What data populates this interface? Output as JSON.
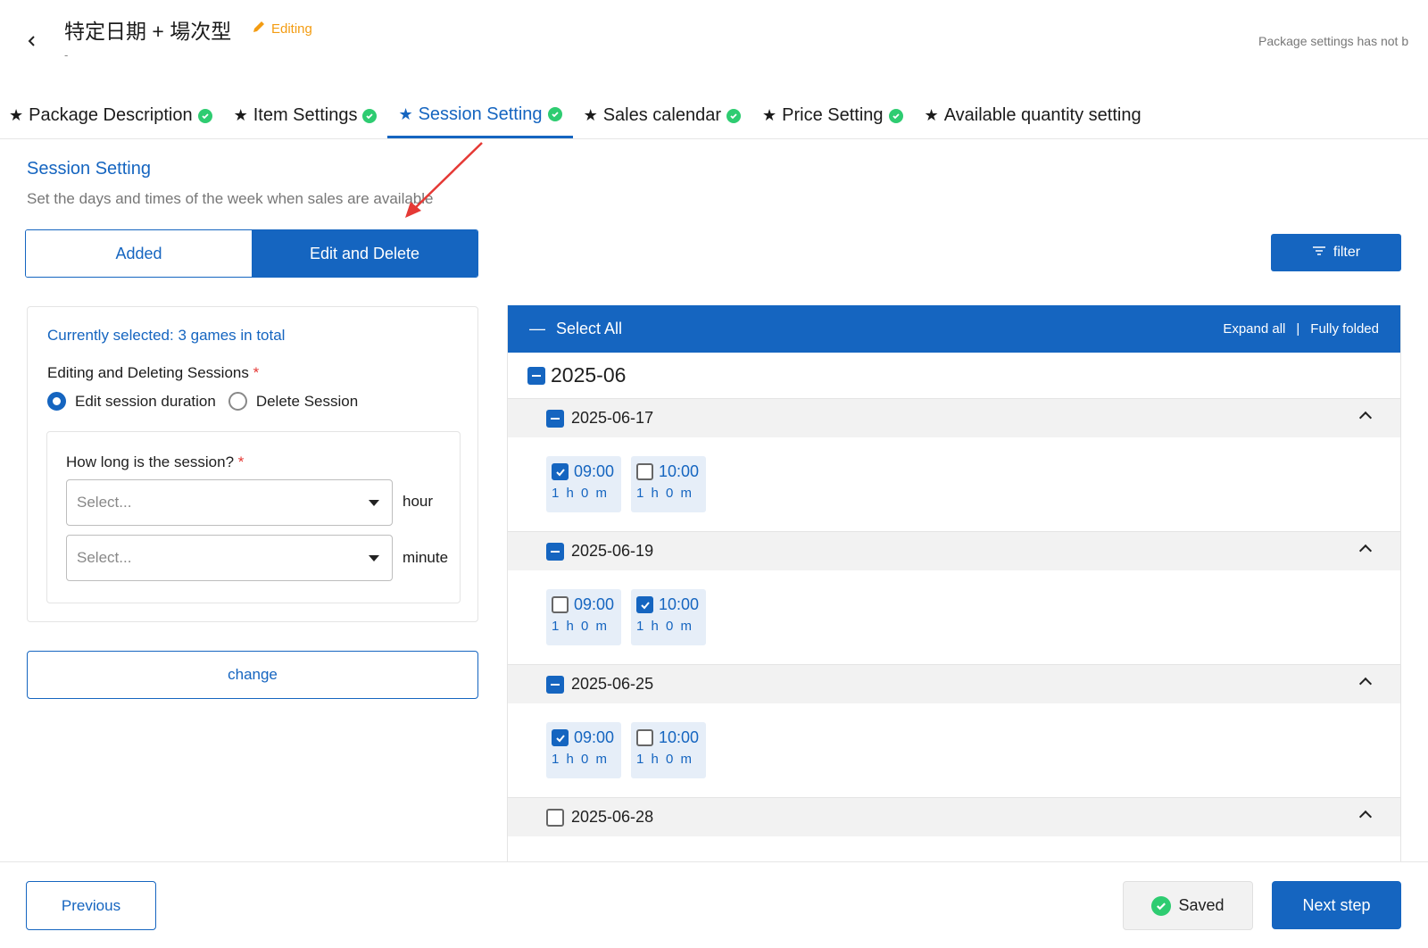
{
  "header": {
    "title": "特定日期 + 場次型",
    "editing_label": "Editing",
    "subtitle": "-",
    "status_text": "Package settings has not b"
  },
  "tabs": [
    {
      "label": "Package Description",
      "complete": true
    },
    {
      "label": "Item Settings",
      "complete": true
    },
    {
      "label": "Session Setting",
      "complete": true,
      "active": true
    },
    {
      "label": "Sales calendar",
      "complete": true
    },
    {
      "label": "Price Setting",
      "complete": true
    },
    {
      "label": "Available quantity setting",
      "complete": false
    }
  ],
  "section": {
    "title": "Session Setting",
    "description": "Set the days and times of the week when sales are available"
  },
  "mode_toggle": {
    "added_label": "Added",
    "edit_label": "Edit and Delete",
    "active": "edit"
  },
  "filter_label": "filter",
  "left_panel": {
    "selected_count": "Currently selected: 3 games in total",
    "edit_label": "Editing and Deleting Sessions",
    "option_edit": "Edit session duration",
    "option_delete": "Delete Session",
    "duration_label": "How long is the session?",
    "hour_placeholder": "Select...",
    "hour_unit": "hour",
    "minute_placeholder": "Select...",
    "minute_unit": "minute",
    "change_label": "change"
  },
  "tree": {
    "select_all_label": "Select All",
    "expand_all_label": "Expand all",
    "separator": "|",
    "fully_folded_label": "Fully folded",
    "month": "2025-06",
    "days": [
      {
        "date": "2025-06-17",
        "state": "partial",
        "slots": [
          {
            "time": "09:00",
            "duration": "1 h 0 m",
            "checked": true
          },
          {
            "time": "10:00",
            "duration": "1 h 0 m",
            "checked": false
          }
        ]
      },
      {
        "date": "2025-06-19",
        "state": "partial",
        "slots": [
          {
            "time": "09:00",
            "duration": "1 h 0 m",
            "checked": false
          },
          {
            "time": "10:00",
            "duration": "1 h 0 m",
            "checked": true
          }
        ]
      },
      {
        "date": "2025-06-25",
        "state": "partial",
        "slots": [
          {
            "time": "09:00",
            "duration": "1 h 0 m",
            "checked": true
          },
          {
            "time": "10:00",
            "duration": "1 h 0 m",
            "checked": false
          }
        ]
      },
      {
        "date": "2025-06-28",
        "state": "empty",
        "slots": []
      }
    ]
  },
  "footer": {
    "previous_label": "Previous",
    "saved_label": "Saved",
    "next_label": "Next step"
  },
  "colors": {
    "primary": "#1565c0",
    "success": "#2ecc71",
    "warning": "#f39c12",
    "annotation": "#e53935"
  }
}
